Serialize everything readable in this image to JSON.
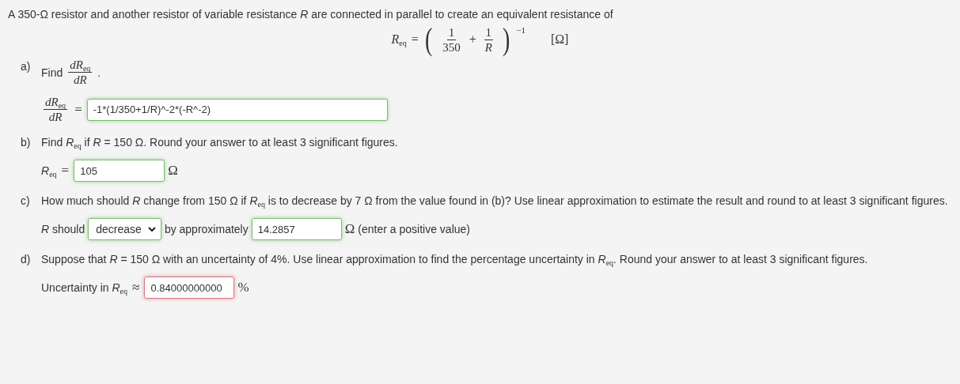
{
  "intro": "A 350-Ω resistor and another resistor of variable resistance *R* are connected in parallel to create an equivalent resistance of",
  "formula": {
    "lhs": "*R*$_{eq}$",
    "relation": "=",
    "open": "(",
    "term1": {
      "num": "1",
      "den": "350"
    },
    "plus": "+",
    "term2": {
      "num": "1",
      "den": "*R*"
    },
    "close": ")",
    "exponent": "−1",
    "unit": "[Ω]"
  },
  "parts": [
    {
      "kind": "derivative",
      "label": "a)",
      "prompt": "Find",
      "fraction": {
        "num": "*dR*$_{eq}$",
        "den": "*dR*"
      },
      "period": ".",
      "answer_lhs": {
        "num": "*dR*$_{eq}$",
        "den": "*dR*"
      },
      "relation": "=",
      "answer": {
        "value": "-1*(1/350+1/R)^-2*(-R^-2)",
        "correct": true
      }
    },
    {
      "kind": "value",
      "label": "b)",
      "prompt": "Find *R*$_{eq}$ if *R* = 150 Ω. Round your answer to at least 3 significant figures.",
      "answer_lhs": "*R*$_{eq}$",
      "relation": "=",
      "answer": {
        "value": "105",
        "correct": true
      },
      "unit": "Ω"
    },
    {
      "kind": "change",
      "label": "c)",
      "prompt": "How much should *R* change from 150 Ω if *R*$_{eq}$ is to decrease by 7 Ω from the value found in (b)? Use linear approximation to estimate the result and round to at least 3 significant figures.",
      "before": "*R* should",
      "select": {
        "value": "decrease",
        "correct": true
      },
      "middle": "by approximately",
      "answer": {
        "value": "14.2857",
        "correct": true
      },
      "unit": "Ω",
      "note": "(enter a positive value)"
    },
    {
      "kind": "value",
      "label": "d)",
      "prompt": "Suppose that *R* = 150 Ω with an uncertainty of 4%. Use linear approximation to find the percentage uncertainty in *R*$_{eq}$. Round your answer to at least 3 significant figures.",
      "answer_lhs": "Uncertainty in *R*$_{eq}$",
      "relation": "≈",
      "answer": {
        "value": "0.84000000000",
        "correct": false
      },
      "unit": "%"
    }
  ]
}
